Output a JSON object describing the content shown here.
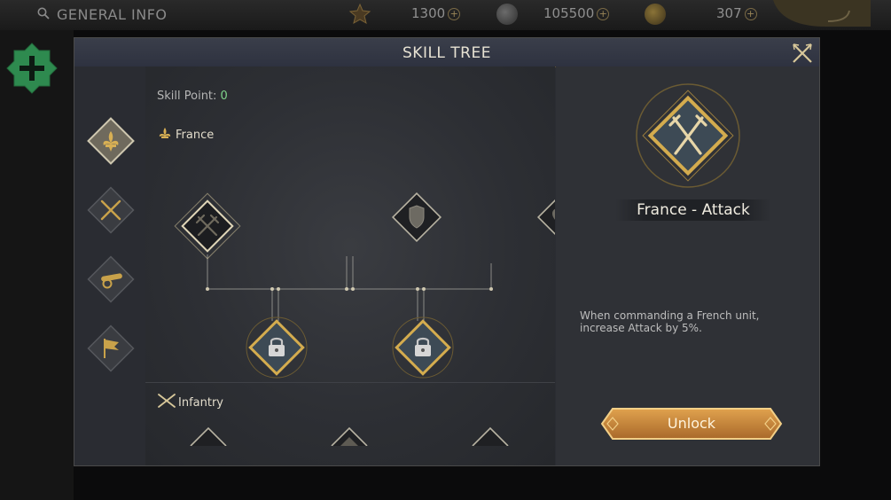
{
  "topbar": {
    "title": "GENERAL INFO",
    "resources": [
      {
        "name": "crest",
        "value": "1300"
      },
      {
        "name": "silver",
        "value": "105500"
      },
      {
        "name": "gold",
        "value": "307"
      }
    ]
  },
  "modal": {
    "title": "SKILL TREE",
    "skill_point_label": "Skill Point:",
    "skill_point_value": "0",
    "sections": [
      {
        "name": "France",
        "icon": "fleur-de-lis-icon"
      },
      {
        "name": "Infantry",
        "icon": "crossed-muskets-icon"
      }
    ],
    "tabs": [
      {
        "name": "france",
        "icon": "fleur-de-lis-icon",
        "selected": true
      },
      {
        "name": "infantry",
        "icon": "crossed-muskets-icon",
        "selected": false
      },
      {
        "name": "artillery",
        "icon": "cannon-icon",
        "selected": false
      },
      {
        "name": "command",
        "icon": "flag-icon",
        "selected": false
      }
    ],
    "nodes": [
      {
        "name": "attack",
        "icon": "crossed-swords-icon",
        "state": "selected"
      },
      {
        "name": "defense",
        "icon": "shield-icon",
        "state": "available"
      },
      {
        "name": "health",
        "icon": "heart-icon",
        "state": "available"
      },
      {
        "name": "locked-1",
        "icon": "lock-icon",
        "state": "locked"
      },
      {
        "name": "locked-2",
        "icon": "lock-icon",
        "state": "locked"
      }
    ]
  },
  "detail": {
    "skill_name": "France - Attack",
    "description": "When commanding a French unit, increase Attack by 5%.",
    "unlock_label": "Unlock"
  },
  "colors": {
    "gold": "#c9a24a",
    "dark_panel": "#2b2d33",
    "green_accent": "#2e8a4f",
    "skill_point_green": "#7fd48a"
  }
}
